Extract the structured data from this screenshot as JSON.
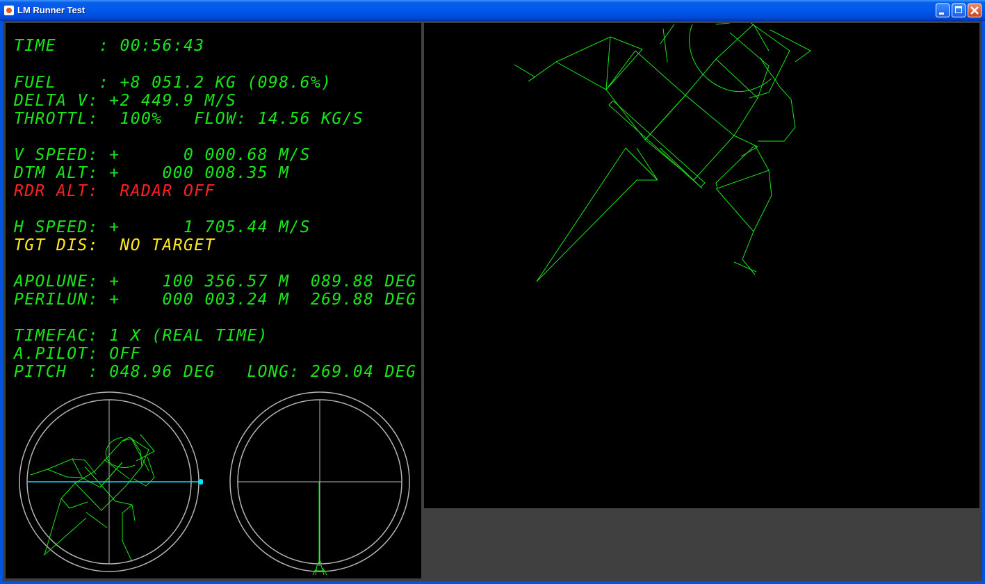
{
  "window": {
    "title": "LM Runner Test",
    "controls": {
      "minimize": "minimize",
      "maximize": "maximize",
      "close": "close"
    }
  },
  "telemetry": [
    {
      "key": "time",
      "text": "TIME    : 00:56:43",
      "color": "#19e619"
    },
    {
      "key": "fuel",
      "text": "FUEL    : +8 051.2 KG (098.6%)",
      "color": "#19e619"
    },
    {
      "key": "delta_v",
      "text": "DELTA V: +2 449.9 M/S",
      "color": "#19e619"
    },
    {
      "key": "throttle",
      "text": "THROTTL:  100%   FLOW: 14.56 KG/S",
      "color": "#19e619"
    },
    {
      "key": "v_speed",
      "text": "V SPEED: +      0 000.68 M/S",
      "color": "#19e619"
    },
    {
      "key": "dtm_alt",
      "text": "DTM ALT: +    000 008.35 M",
      "color": "#19e619"
    },
    {
      "key": "rdr_alt",
      "text": "RDR ALT:  RADAR OFF",
      "color": "#ff2020"
    },
    {
      "key": "h_speed",
      "text": "H SPEED: +      1 705.44 M/S",
      "color": "#19e619"
    },
    {
      "key": "tgt_dis",
      "text": "TGT DIS:  NO TARGET",
      "color": "#ffea20"
    },
    {
      "key": "apolune",
      "text": "APOLUNE: +    100 356.57 M  089.88 DEG",
      "color": "#19e619"
    },
    {
      "key": "perilun",
      "text": "PERILUN: +    000 003.24 M  269.88 DEG",
      "color": "#19e619"
    },
    {
      "key": "timefac",
      "text": "TIMEFAC: 1 X (REAL TIME)",
      "color": "#19e619"
    },
    {
      "key": "a_pilot",
      "text": "A.PILOT: OFF",
      "color": "#19e619"
    },
    {
      "key": "pitch",
      "text": "PITCH  : 048.96 DEG   LONG: 269.04 DEG",
      "color": "#19e619"
    }
  ],
  "colors": {
    "readout_green": "#19e619",
    "warning_red": "#ff2020",
    "caution_yellow": "#ffea20",
    "wireframe": "#19e619",
    "indicator_cyan": "#00e0ff",
    "gauge_ring": "#b4b4b4",
    "panel_bg": "#000000",
    "frame_gray": "#404040",
    "titlebar_blue": "#0054e3"
  },
  "icons": [
    "java-app-icon",
    "minimize-icon",
    "maximize-icon",
    "close-icon",
    "attitude-indicator",
    "horizon-indicator",
    "lander-wireframe"
  ]
}
